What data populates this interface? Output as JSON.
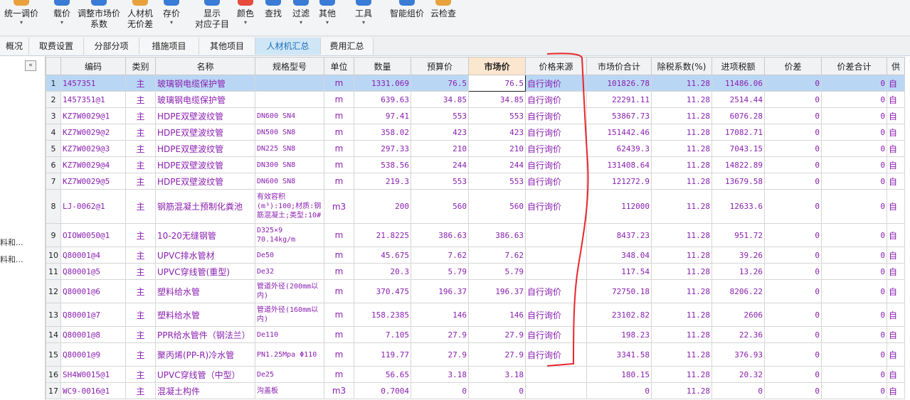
{
  "toolbar": {
    "items": [
      {
        "label": "统一调价",
        "icon": "adjust-price-icon",
        "color": "#e8a23c"
      },
      {
        "label": "载价",
        "icon": "load-price-icon",
        "color": "#3a7bd5"
      },
      {
        "label": "调整市场价\n系数",
        "icon": "market-coefficient-icon",
        "color": "#3a7bd5"
      },
      {
        "label": "人材机\n无价差",
        "icon": "no-price-diff-icon",
        "color": "#e8a23c"
      },
      {
        "label": "存价",
        "icon": "save-price-icon",
        "color": "#3a7bd5"
      },
      {
        "label": "显示\n对应子目",
        "icon": "show-subitem-icon",
        "color": "#3a7bd5"
      },
      {
        "label": "颜色",
        "icon": "color-icon",
        "color": "#e64b3c"
      },
      {
        "label": "查找",
        "icon": "find-icon",
        "color": "#3a7bd5"
      },
      {
        "label": "过滤",
        "icon": "filter-icon",
        "color": "#3a7bd5"
      },
      {
        "label": "其他",
        "icon": "other-icon",
        "color": "#3a7bd5"
      },
      {
        "label": "工具",
        "icon": "tools-icon",
        "color": "#3a7bd5"
      },
      {
        "label": "智能组价",
        "icon": "smart-pricing-icon",
        "color": "#3a7bd5"
      },
      {
        "label": "云检查",
        "icon": "cloud-check-icon",
        "color": "#e8a23c"
      }
    ]
  },
  "tabs": [
    "概况",
    "取费设置",
    "分部分项",
    "措施项目",
    "其他项目",
    "人材机汇总",
    "费用汇总"
  ],
  "active_tab": "人材机汇总",
  "leftpanel": {
    "collapse": "«",
    "items": [
      "料和...",
      "料和..."
    ]
  },
  "table": {
    "headers": [
      "编码",
      "类别",
      "名称",
      "规格型号",
      "单位",
      "数量",
      "预算价",
      "市场价",
      "价格来源",
      "市场价合计",
      "除税系数(%)",
      "进项税额",
      "价差",
      "价差合计",
      "供"
    ],
    "rows": [
      [
        "1",
        "1457351",
        "主",
        "玻璃钢电缆保护管",
        "",
        "m",
        "1331.069",
        "76.5",
        "76.5",
        "自行询价",
        "101826.78",
        "11.28",
        "11486.06",
        "0",
        "0",
        "自"
      ],
      [
        "2",
        "1457351@1",
        "主",
        "玻璃钢电缆保护管",
        "",
        "m",
        "639.63",
        "34.85",
        "34.85",
        "自行询价",
        "22291.11",
        "11.28",
        "2514.44",
        "0",
        "0",
        "自"
      ],
      [
        "3",
        "KZ7W0029@1",
        "主",
        "HDPE双壁波纹管",
        "DN600 SN4",
        "m",
        "97.41",
        "553",
        "553",
        "自行询价",
        "53867.73",
        "11.28",
        "6076.28",
        "0",
        "0",
        "自"
      ],
      [
        "4",
        "KZ7W0029@2",
        "主",
        "HDPE双壁波纹管",
        "DN500 SN8",
        "m",
        "358.02",
        "423",
        "423",
        "自行询价",
        "151442.46",
        "11.28",
        "17082.71",
        "0",
        "0",
        "自"
      ],
      [
        "5",
        "KZ7W0029@3",
        "主",
        "HDPE双壁波纹管",
        "DN225 SN8",
        "m",
        "297.33",
        "210",
        "210",
        "自行询价",
        "62439.3",
        "11.28",
        "7043.15",
        "0",
        "0",
        "自"
      ],
      [
        "6",
        "KZ7W0029@4",
        "主",
        "HDPE双壁波纹管",
        "DN300 SN8",
        "m",
        "538.56",
        "244",
        "244",
        "自行询价",
        "131408.64",
        "11.28",
        "14822.89",
        "0",
        "0",
        "自"
      ],
      [
        "7",
        "KZ7W0029@5",
        "主",
        "HDPE双壁波纹管",
        "DN600 SN8",
        "m",
        "219.3",
        "553",
        "553",
        "自行询价",
        "121272.9",
        "11.28",
        "13679.58",
        "0",
        "0",
        "自"
      ],
      [
        "8",
        "LJ-0062@1",
        "主",
        "钢筋混凝土预制化粪池",
        "有效容积(m³):100;材质:钢筋混凝土;类型:10#",
        "m3",
        "200",
        "560",
        "560",
        "自行询价",
        "112000",
        "11.28",
        "12633.6",
        "0",
        "0",
        "自"
      ],
      [
        "9",
        "OIOW0050@1",
        "主",
        "10-20无缝钢管",
        "D325×9 70.14kg/m",
        "m",
        "21.8225",
        "386.63",
        "386.63",
        "",
        "8437.23",
        "11.28",
        "951.72",
        "0",
        "0",
        "自"
      ],
      [
        "10",
        "Q80001@4",
        "主",
        "UPVC排水管材",
        "De50",
        "m",
        "45.675",
        "7.62",
        "7.62",
        "",
        "348.04",
        "11.28",
        "39.26",
        "0",
        "0",
        "自"
      ],
      [
        "11",
        "Q80001@5",
        "主",
        "UPVC穿线管(重型)",
        "De32",
        "m",
        "20.3",
        "5.79",
        "5.79",
        "",
        "117.54",
        "11.28",
        "13.26",
        "0",
        "0",
        "自"
      ],
      [
        "12",
        "Q80001@6",
        "主",
        "塑料给水管",
        "管道外径(200mm以内)",
        "m",
        "370.475",
        "196.37",
        "196.37",
        "自行询价",
        "72750.18",
        "11.28",
        "8206.22",
        "0",
        "0",
        "自"
      ],
      [
        "13",
        "Q80001@7",
        "主",
        "塑料给水管",
        "管道外径(160mm以内)",
        "m",
        "158.2385",
        "146",
        "146",
        "自行询价",
        "23102.82",
        "11.28",
        "2606",
        "0",
        "0",
        "自"
      ],
      [
        "14",
        "Q80001@8",
        "主",
        "PPR给水管件（钢法兰）",
        "De110",
        "m",
        "7.105",
        "27.9",
        "27.9",
        "自行询价",
        "198.23",
        "11.28",
        "22.36",
        "0",
        "0",
        "自"
      ],
      [
        "15",
        "Q80001@9",
        "主",
        "聚丙烯(PP-R)冷水管",
        "PN1.25Mpa Φ110",
        "m",
        "119.77",
        "27.9",
        "27.9",
        "自行询价",
        "3341.58",
        "11.28",
        "376.93",
        "0",
        "0",
        "自"
      ],
      [
        "16",
        "SH4W0015@1",
        "主",
        "UPVC穿线管（中型）",
        "De25",
        "m",
        "56.65",
        "3.18",
        "3.18",
        "",
        "180.15",
        "11.28",
        "20.32",
        "0",
        "0",
        "自"
      ],
      [
        "17",
        "WC9-0016@1",
        "主",
        "混凝土构件",
        "沟盖板",
        "m3",
        "0.7004",
        "0",
        "0",
        "",
        "0",
        "11.28",
        "0",
        "0",
        "0",
        "自"
      ]
    ]
  },
  "colors": {
    "text": "#8a1fb0",
    "selected": "#b9d7f5",
    "annotation": "#e8262a"
  }
}
